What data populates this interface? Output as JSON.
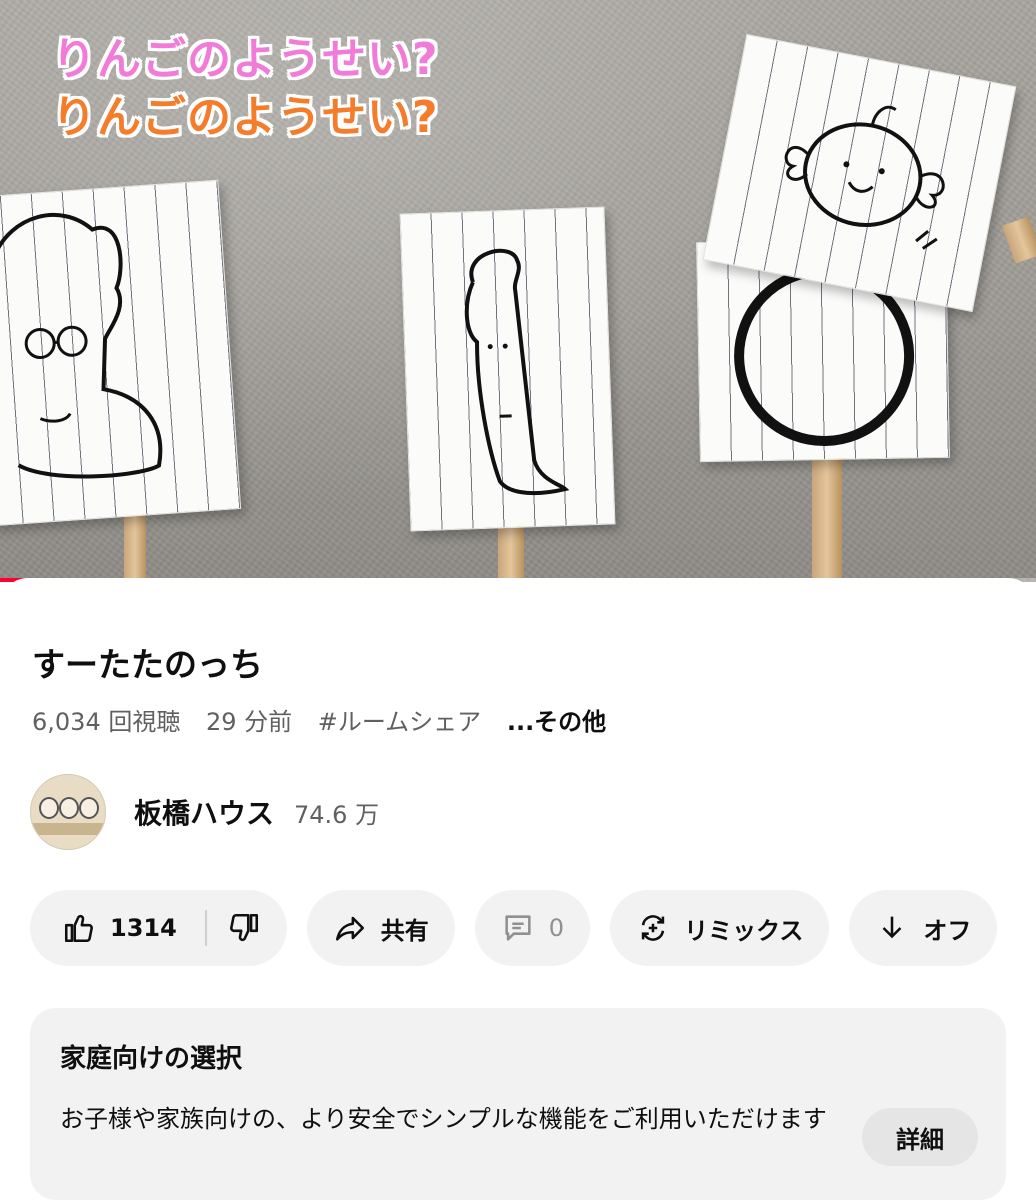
{
  "video": {
    "caption_line_1": "りんごのようせい?",
    "caption_line_2": "りんごのようせい?",
    "progress_fraction": 0.1
  },
  "info": {
    "title": "すーたたのっち",
    "views": "6,034 回視聴",
    "time_ago": "29 分前",
    "hashtag": "#ルームシェア",
    "more": "...その他"
  },
  "channel": {
    "name": "板橋ハウス",
    "subscribers": "74.6 万",
    "avatar_icon": "channel-avatar"
  },
  "actions": {
    "like_count": "1314",
    "share_label": "共有",
    "comment_count": "0",
    "remix_label": "リミックス",
    "offline_label": "オフ",
    "like_icon": "thumb-up-icon",
    "dislike_icon": "thumb-down-icon",
    "share_icon": "share-arrow-icon",
    "comment_icon": "comment-icon",
    "remix_icon": "remix-icon",
    "download_icon": "download-icon"
  },
  "family": {
    "title": "家庭向けの選択",
    "description": "お子様や家族向けの、より安全でシンプルな機能をご利用いただけます",
    "details_label": "詳細"
  },
  "colors": {
    "caption_pink": "#f27ad8",
    "caption_orange": "#f47c2a",
    "progress_red": "#ff0033",
    "pill_bg": "#f2f2f2",
    "secondary_text": "#606060"
  }
}
